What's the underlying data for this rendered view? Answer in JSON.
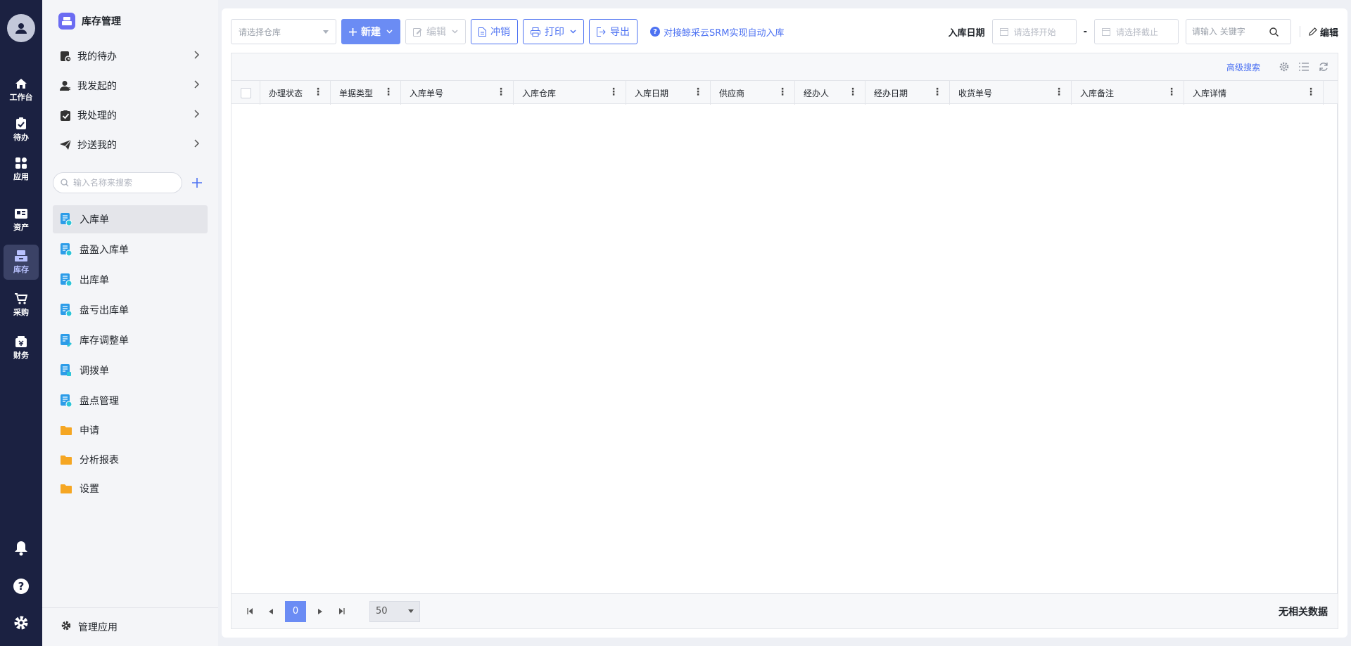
{
  "rail": {
    "items": [
      {
        "label": "工作台",
        "icon": "home-icon"
      },
      {
        "label": "待办",
        "icon": "clipboard-check-icon"
      },
      {
        "label": "应用",
        "icon": "apps-grid-icon"
      },
      {
        "label": "资产",
        "icon": "asset-card-icon"
      },
      {
        "label": "库存",
        "icon": "inventory-box-icon",
        "active": true
      },
      {
        "label": "采购",
        "icon": "cart-icon"
      },
      {
        "label": "财务",
        "icon": "finance-wallet-icon"
      }
    ],
    "bottom_icons": [
      "bell-icon",
      "help-icon",
      "settings-gear-icon"
    ]
  },
  "sidebar": {
    "module_title": "库存管理",
    "tasks": [
      {
        "label": "我的待办",
        "icon": "todo-icon"
      },
      {
        "label": "我发起的",
        "icon": "user-icon"
      },
      {
        "label": "我处理的",
        "icon": "check-box-icon"
      },
      {
        "label": "抄送我的",
        "icon": "paper-plane-icon"
      }
    ],
    "search_placeholder": "输入名称来搜索",
    "nav": [
      {
        "label": "入库单",
        "icon": "form-icon",
        "active": true
      },
      {
        "label": "盘盈入库单",
        "icon": "form-icon"
      },
      {
        "label": "出库单",
        "icon": "form-icon"
      },
      {
        "label": "盘亏出库单",
        "icon": "form-icon"
      },
      {
        "label": "库存调整单",
        "icon": "form-icon"
      },
      {
        "label": "调拨单",
        "icon": "form-icon"
      },
      {
        "label": "盘点管理",
        "icon": "form-icon"
      },
      {
        "label": "申请",
        "icon": "folder-icon"
      },
      {
        "label": "分析报表",
        "icon": "folder-icon"
      },
      {
        "label": "设置",
        "icon": "folder-icon"
      }
    ],
    "footer_label": "管理应用"
  },
  "toolbar": {
    "warehouse_placeholder": "请选择仓库",
    "new_label": "新建",
    "edit_label": "编辑",
    "writeoff_label": "冲销",
    "print_label": "打印",
    "export_label": "导出",
    "srm_tip": "对接鲸采云SRM实现自动入库",
    "date_label": "入库日期",
    "date_start_placeholder": "请选择开始",
    "date_end_placeholder": "请选择截止",
    "dash": "-",
    "keyword_placeholder": "请输入 关键字",
    "edit_view_label": "编辑"
  },
  "table": {
    "advanced_search": "高级搜索",
    "columns": [
      {
        "label": "办理状态",
        "width": 82
      },
      {
        "label": "单据类型",
        "width": 82
      },
      {
        "label": "入库单号",
        "width": 131
      },
      {
        "label": "入库仓库",
        "width": 131
      },
      {
        "label": "入库日期",
        "width": 98
      },
      {
        "label": "供应商",
        "width": 98
      },
      {
        "label": "经办人",
        "width": 82
      },
      {
        "label": "经办日期",
        "width": 98
      },
      {
        "label": "收货单号",
        "width": 141
      },
      {
        "label": "入库备注",
        "width": 131
      },
      {
        "label": "入库详情",
        "width": 162
      }
    ],
    "rows": []
  },
  "pager": {
    "current_page": "0",
    "page_size": "50",
    "empty_text": "无相关数据"
  },
  "colors": {
    "rail_bg": "#1b2141",
    "accent": "#4d72f2",
    "primary_button": "#6b8cf4",
    "module_icon": "#6b6cf2"
  }
}
